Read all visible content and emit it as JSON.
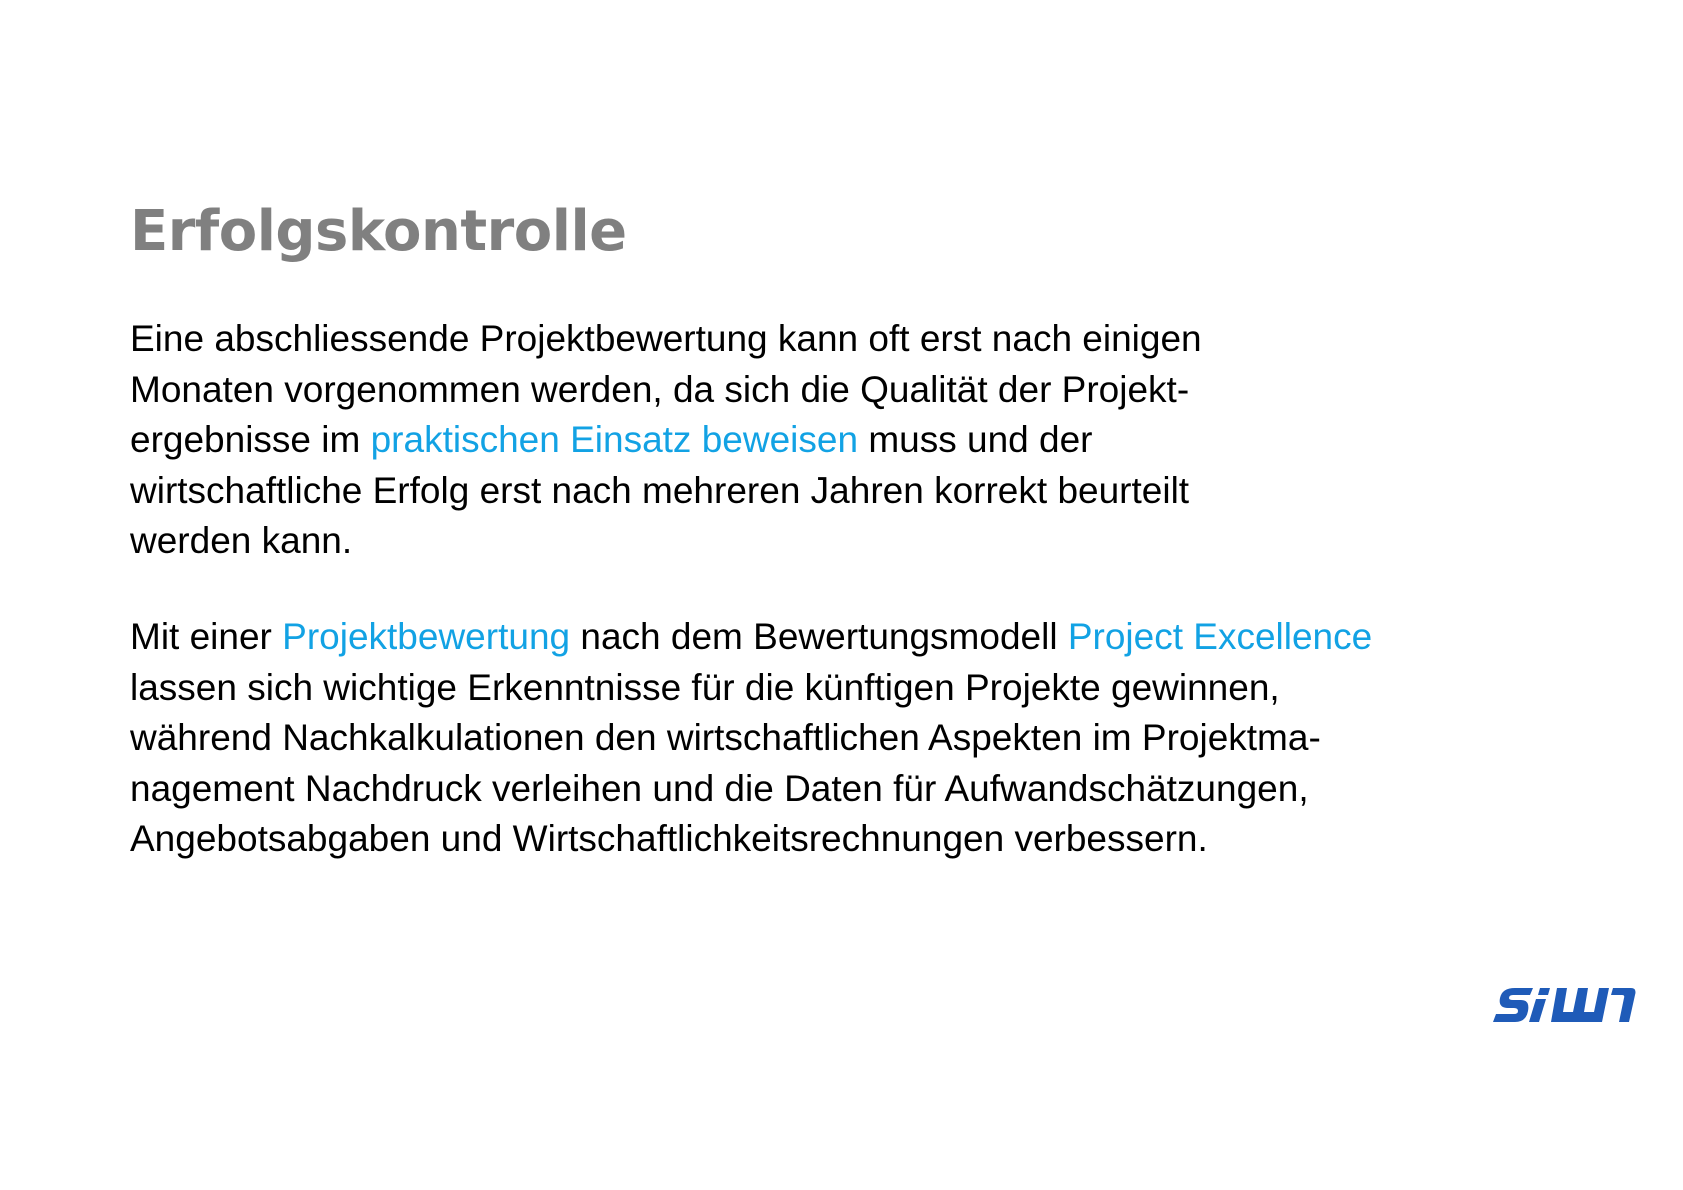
{
  "title": "Erfolgskontrolle",
  "paragraph1": {
    "line1": "Eine abschliessende Projektbewertung kann oft erst nach einigen",
    "line2": "Monaten vorgenommen werden, da sich die Qualität der Projekt-",
    "line3_before": "ergebnisse im ",
    "line3_highlight": "praktischen Einsatz beweisen",
    "line3_after": " muss und der",
    "line4": "wirtschaftliche Erfolg erst nach mehreren Jahren korrekt beurteilt",
    "line5": "werden kann."
  },
  "paragraph2": {
    "line1_before": "Mit einer ",
    "line1_highlight1": "Projektbewertung",
    "line1_middle": " nach dem Bewertungsmodell ",
    "line1_highlight2": "Project Excellence",
    "line2": "lassen sich wichtige Erkenntnisse für die künftigen Projekte gewinnen,",
    "line3": "während Nachkalkulationen den wirtschaftlichen Aspekten im Projektma-",
    "line4": "nagement Nachdruck verleihen und die Daten für Aufwandschätzungen,",
    "line5": "Angebotsabgaben und Wirtschaftlichkeitsrechnungen verbessern."
  },
  "colors": {
    "title": "#808080",
    "body_text": "#000000",
    "highlight": "#12A2E4",
    "logo": "#1F5BB8"
  },
  "logo": {
    "icon": "siw-logo",
    "text": "SiW"
  }
}
